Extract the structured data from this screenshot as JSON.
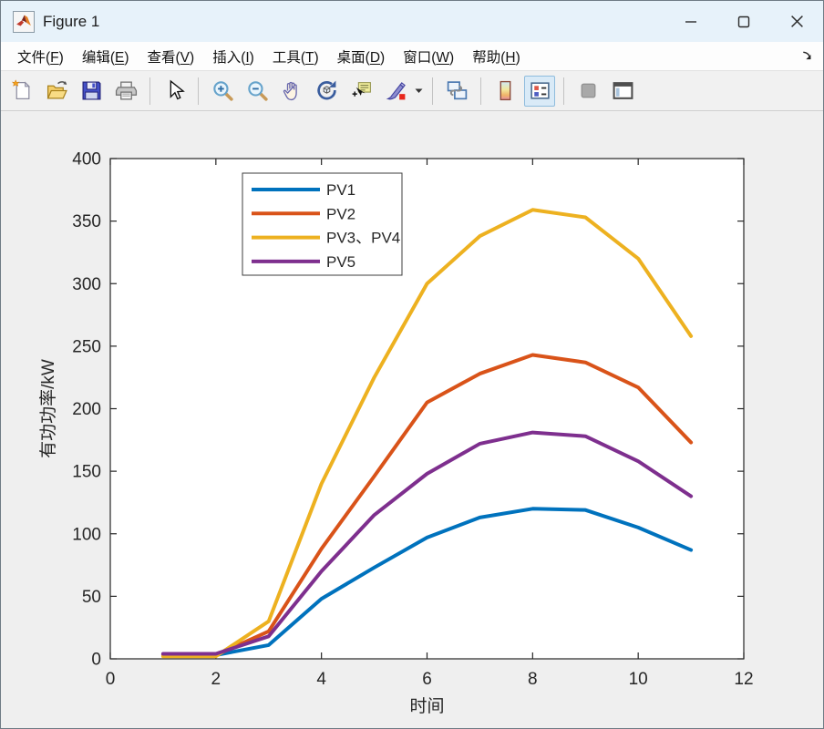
{
  "window": {
    "title": "Figure 1",
    "controls": [
      {
        "name": "minimize"
      },
      {
        "name": "maximize"
      },
      {
        "name": "close"
      }
    ]
  },
  "menubar": {
    "items": [
      {
        "pre": "文件(",
        "key": "F",
        "post": ")"
      },
      {
        "pre": "编辑(",
        "key": "E",
        "post": ")"
      },
      {
        "pre": "查看(",
        "key": "V",
        "post": ")"
      },
      {
        "pre": "插入(",
        "key": "I",
        "post": ")"
      },
      {
        "pre": "工具(",
        "key": "T",
        "post": ")"
      },
      {
        "pre": "桌面(",
        "key": "D",
        "post": ")"
      },
      {
        "pre": "窗口(",
        "key": "W",
        "post": ")"
      },
      {
        "pre": "帮助(",
        "key": "H",
        "post": ")"
      }
    ],
    "dock_arrow_icon": "dock-arrow"
  },
  "toolbar": {
    "icons": [
      "new-figure-icon",
      "open-file-icon",
      "save-figure-icon",
      "print-figure-icon",
      "edit-cursor-icon",
      "zoom-in-icon",
      "zoom-out-icon",
      "pan-hand-icon",
      "rotate-3d-icon",
      "data-cursor-icon",
      "brush-data-icon",
      "brush-dropdown-caret-icon",
      "link-plot-icon",
      "insert-colorbar-icon",
      "insert-legend-icon",
      "plot-tools-off-icon",
      "dock-plot-tools-icon"
    ],
    "legend_toggle_state": "active"
  },
  "chart_data": {
    "type": "line",
    "x": [
      1,
      2,
      3,
      4,
      5,
      6,
      7,
      8,
      9,
      10,
      11
    ],
    "series": [
      {
        "name": "PV1",
        "color": "#0072BD",
        "values": [
          3,
          3,
          11,
          48,
          73,
          97,
          113,
          120,
          119,
          105,
          87
        ]
      },
      {
        "name": "PV2",
        "color": "#D95319",
        "values": [
          3,
          3,
          22,
          88,
          146,
          205,
          228,
          243,
          237,
          217,
          173
        ]
      },
      {
        "name": "PV3、PV4",
        "color": "#EDB120",
        "values": [
          2,
          2,
          30,
          140,
          225,
          300,
          338,
          359,
          353,
          320,
          258
        ]
      },
      {
        "name": "PV5",
        "color": "#7E2F8E",
        "values": [
          4,
          4,
          18,
          70,
          115,
          148,
          172,
          181,
          178,
          158,
          130
        ]
      }
    ],
    "xlabel": "时间",
    "ylabel": "有功功率/kW",
    "xlim": [
      0,
      12
    ],
    "ylim": [
      0,
      400
    ],
    "x_ticks": [
      0,
      2,
      4,
      6,
      8,
      10,
      12
    ],
    "y_ticks": [
      0,
      50,
      100,
      150,
      200,
      250,
      300,
      350,
      400
    ],
    "grid": false,
    "box": true,
    "tick_dir": "in",
    "legend_position": "inside-top-left",
    "axis_color": "#262626",
    "plot_bg": "#ffffff",
    "figure_bg": "#efefef",
    "line_width": 4
  }
}
